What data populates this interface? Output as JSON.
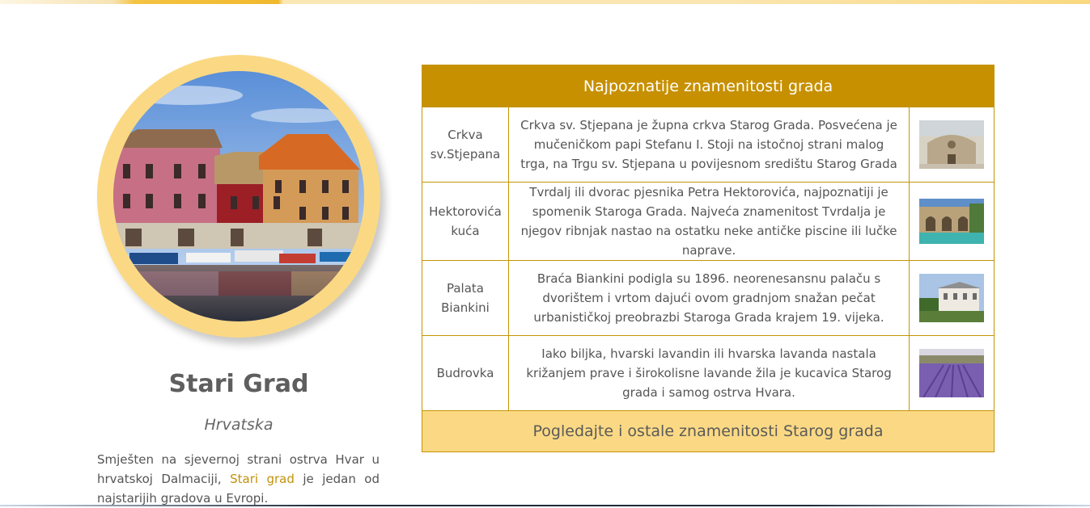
{
  "city": {
    "name": "Stari Grad",
    "country": "Hrvatska",
    "intro_before": "Smješten na sjevernoj strani ostrva Hvar u hrvatskoj Dalmaciji,",
    "intro_link": "Stari grad",
    "intro_after": "je jedan od najstarijih gradova u Evropi."
  },
  "table": {
    "title": "Najpoznatije znamenitosti grada",
    "rows": [
      {
        "name": "Crkva sv.Stjepana",
        "description": "Crkva sv. Stjepana je župna crkva Starog Grada. Posvećena je mučeničkom papi Stefanu I. Stoji na istočnoj strani malog trga, na Trgu sv. Stjepana u povijesnom središtu Starog Grada"
      },
      {
        "name": "Hektorovića kuća",
        "description": "Tvrdalj ili dvorac pjesnika Petra Hektorovića, najpoznatiji je spomenik Staroga Grada. Najveća znamenitost Tvrdalja je njegov ribnjak nastao na ostatku neke antičke piscine ili lučke naprave."
      },
      {
        "name": "Palata Biankini",
        "description": "Braća Biankini podigla su 1896. neorenesansnu palaču s dvorištem i vrtom dajući ovom gradnjom snažan pečat urbanističkoj preobrazbi Staroga Grada krajem 19. vijeka."
      },
      {
        "name": "Budrovka",
        "description": "Iako biljka, hvarski lavandin ili hvarska lavanda nastala križanjem prave i širokolisne lavande žila je kucavica Starog grada i samog ostrva Hvara."
      }
    ],
    "footer": "Pogledajte i ostale znamenitosti Starog grada"
  },
  "colors": {
    "accent": "#c79000",
    "light_accent": "#fbd984",
    "link": "#c2910a"
  }
}
